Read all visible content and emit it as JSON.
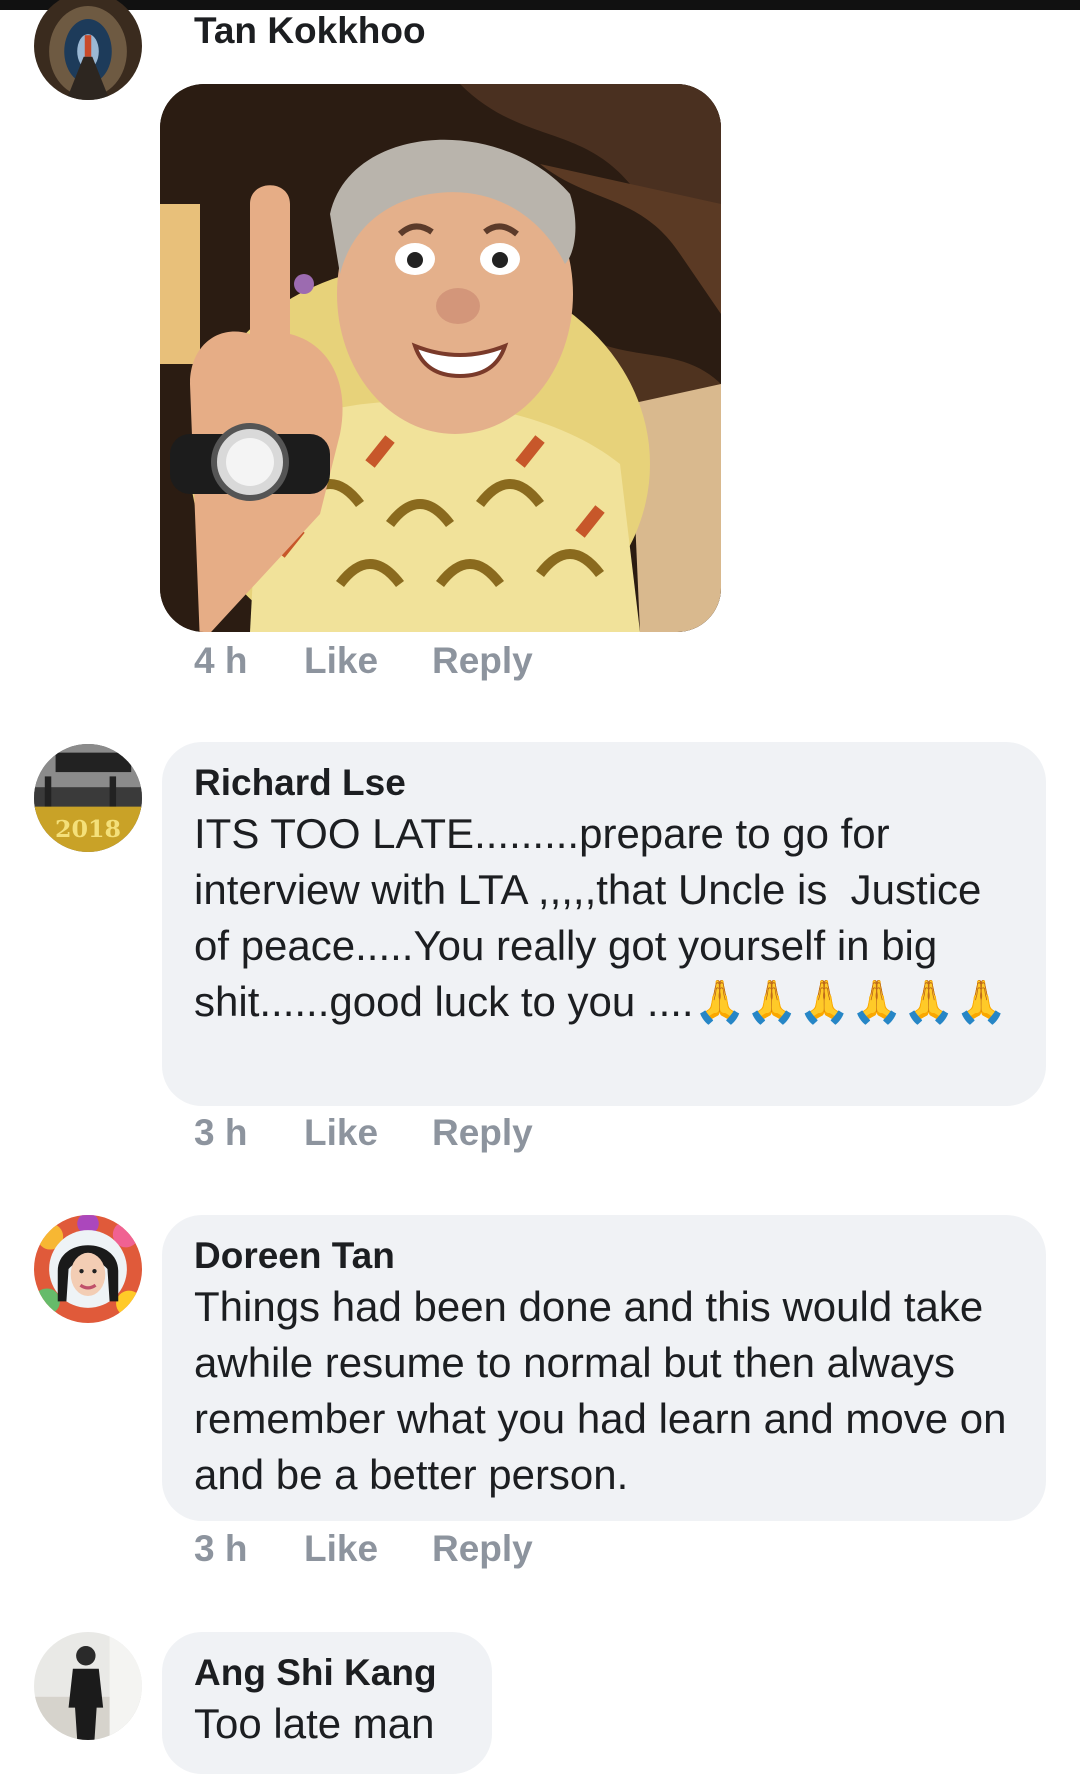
{
  "comments": [
    {
      "author": "Tan Kokkhoo",
      "avatar": "tunnel-photo-avatar",
      "attachment": "sticker-photo-man-gesture",
      "time": "4 h",
      "like_label": "Like",
      "reply_label": "Reply"
    },
    {
      "author": "Richard Lse",
      "avatar": "2018-badge-avatar",
      "text": "ITS TOO LATE.........prepare to go for interview with LTA ,,,,,that Uncle is  Justice of peace.....You really got yourself in big shit......good luck to you ....",
      "emoji": "🙏🙏🙏🙏🙏🙏",
      "time": "3 h",
      "like_label": "Like",
      "reply_label": "Reply"
    },
    {
      "author": "Doreen Tan",
      "avatar": "flower-frame-avatar",
      "text": "Things had been done and this would take awhile resume to normal but then always remember what you had learn and move on and be a better person.",
      "time": "3 h",
      "like_label": "Like",
      "reply_label": "Reply"
    },
    {
      "author": "Ang Shi Kang",
      "avatar": "person-standing-avatar",
      "text": "Too late man"
    }
  ],
  "colors": {
    "bubble_bg": "#f0f2f5",
    "meta_text": "#8d949e",
    "name_text": "#1c1e21"
  }
}
